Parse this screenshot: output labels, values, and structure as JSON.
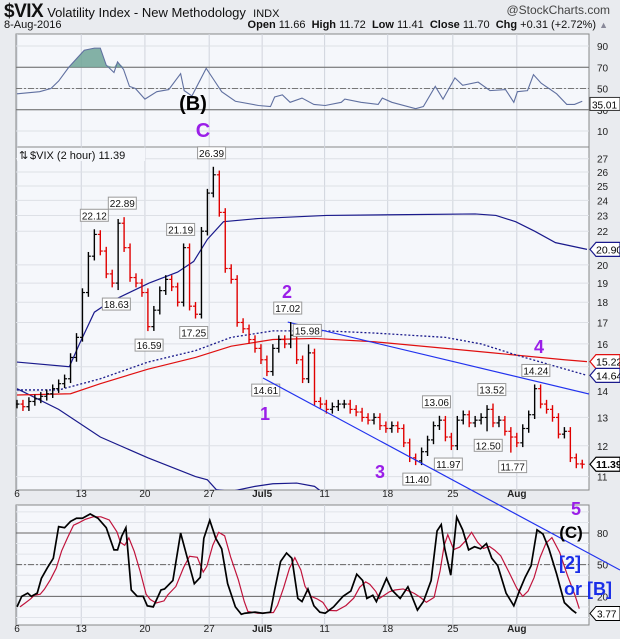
{
  "header": {
    "symbol": "$VIX",
    "name": "Volatility Index - New Methodology",
    "exchange": "INDX",
    "brand": "@StockCharts.com",
    "date": "8-Aug-2016",
    "open_label": "Open",
    "open": "11.66",
    "high_label": "High",
    "high": "11.72",
    "low_label": "Low",
    "low": "11.41",
    "close_label": "Close",
    "close": "11.70",
    "chg_label": "Chg",
    "chg": "+0.31 (+2.72%)",
    "chg_icon": "triangle-up"
  },
  "colors": {
    "up": "#000000",
    "down": "#e00000",
    "band": "#1a1a8c",
    "ma": "#e01010",
    "trend": "#2233ee",
    "wave": "#9a1ee8",
    "rsi": "#6070a0",
    "stochK": "#000000",
    "stochD": "#c0143c"
  },
  "chart_data": [
    {
      "type": "line",
      "name": "RSI",
      "yticks": [
        90,
        70,
        50,
        30,
        10
      ],
      "ylim": [
        -5,
        100
      ],
      "levels": [
        70,
        50,
        30
      ],
      "last_label": "35.01",
      "points": [
        [
          0,
          45
        ],
        [
          3.8,
          47
        ],
        [
          5.7,
          50
        ],
        [
          7,
          57
        ],
        [
          8.7,
          70
        ],
        [
          11.3,
          86
        ],
        [
          13,
          88
        ],
        [
          14,
          88
        ],
        [
          15,
          72
        ],
        [
          16.3,
          65
        ],
        [
          16.9,
          75
        ],
        [
          17.9,
          68
        ],
        [
          18.9,
          52
        ],
        [
          19.9,
          50
        ],
        [
          21.5,
          40
        ],
        [
          23.5,
          47
        ],
        [
          25.5,
          49
        ],
        [
          27.5,
          64
        ],
        [
          28.1,
          48
        ],
        [
          29.4,
          43
        ],
        [
          31.8,
          69
        ],
        [
          33.1,
          58
        ],
        [
          34.4,
          47
        ],
        [
          36.7,
          38
        ],
        [
          40.6,
          34
        ],
        [
          42.6,
          33
        ],
        [
          43.3,
          42
        ],
        [
          44.6,
          44
        ],
        [
          45.9,
          37
        ],
        [
          47.9,
          41
        ],
        [
          49.9,
          35
        ],
        [
          51.8,
          34
        ],
        [
          54.5,
          37
        ],
        [
          55.1,
          40
        ],
        [
          57.8,
          37
        ],
        [
          60.7,
          35
        ],
        [
          61.4,
          41
        ],
        [
          63,
          37
        ],
        [
          67,
          31
        ],
        [
          68.3,
          33
        ],
        [
          70.3,
          52
        ],
        [
          71.6,
          40
        ],
        [
          73.6,
          60
        ],
        [
          74.9,
          53
        ],
        [
          77.5,
          56
        ],
        [
          79.5,
          48
        ],
        [
          82.1,
          49
        ],
        [
          83.5,
          37
        ],
        [
          84.1,
          47
        ],
        [
          85.8,
          48
        ],
        [
          86.8,
          63
        ],
        [
          88.1,
          55
        ],
        [
          90.7,
          45
        ],
        [
          92.4,
          35
        ],
        [
          93.7,
          35
        ],
        [
          95,
          38
        ]
      ]
    },
    {
      "type": "ohlc",
      "name": "$VIX (2 hour)",
      "legend": "$VIX (2 hour) 11.39",
      "scale": "log",
      "yticks": [
        11,
        12,
        13,
        14,
        15,
        16,
        17,
        18,
        19,
        20,
        22,
        23,
        24,
        25,
        26,
        27
      ],
      "ylim": [
        10.5,
        28.5
      ],
      "xticks": [
        {
          "i": 0,
          "label": "6"
        },
        {
          "i": 10.8,
          "label": "13"
        },
        {
          "i": 21.5,
          "label": "20"
        },
        {
          "i": 32.3,
          "label": "27"
        },
        {
          "i": 41.2,
          "label": "Jul5"
        },
        {
          "i": 51.7,
          "label": "11"
        },
        {
          "i": 62.3,
          "label": "18"
        },
        {
          "i": 73.25,
          "label": "25"
        },
        {
          "i": 84,
          "label": "Aug"
        }
      ],
      "closes": [
        13.5,
        13.4,
        13.6,
        13.7,
        13.8,
        13.9,
        14.1,
        14.3,
        14.5,
        15.4,
        16.3,
        18.5,
        20.5,
        21.8,
        20.8,
        19.5,
        19.0,
        22.5,
        21.0,
        19.3,
        19.0,
        18.5,
        16.8,
        17.6,
        18.6,
        19.2,
        18.8,
        18.0,
        21.0,
        17.8,
        17.4,
        22.0,
        24.5,
        25.8,
        23.2,
        19.8,
        19.2,
        17.0,
        16.7,
        16.2,
        15.8,
        15.3,
        14.8,
        15.8,
        16.2,
        16.0,
        16.4,
        15.3,
        14.5,
        15.6,
        13.6,
        13.5,
        13.3,
        13.4,
        13.5,
        13.5,
        13.3,
        13.2,
        13.0,
        12.9,
        13.0,
        12.7,
        12.6,
        12.7,
        12.6,
        12.1,
        11.6,
        11.5,
        11.8,
        12.2,
        12.7,
        12.9,
        12.3,
        12.0,
        12.9,
        13.1,
        12.8,
        12.9,
        13.0,
        13.3,
        12.8,
        12.9,
        12.5,
        12.3,
        12.1,
        12.6,
        13.1,
        14.1,
        13.5,
        13.3,
        13.0,
        12.4,
        12.5,
        11.6,
        11.4,
        11.39
      ],
      "annotations": [
        {
          "i": 13,
          "v": "22.12",
          "pos": "top"
        },
        {
          "i": 17.7,
          "v": "22.89",
          "pos": "top"
        },
        {
          "i": 16.7,
          "v": "18.63",
          "pos": "bottom"
        },
        {
          "i": 22.2,
          "v": "16.59",
          "pos": "bottom"
        },
        {
          "i": 27.5,
          "v": "21.19",
          "pos": "top"
        },
        {
          "i": 29.7,
          "v": "17.25",
          "pos": "bottom"
        },
        {
          "i": 32.7,
          "v": "26.39",
          "pos": "top"
        },
        {
          "i": 45.5,
          "v": "17.02",
          "pos": "top"
        },
        {
          "i": 48.8,
          "v": "15.98",
          "pos": "top"
        },
        {
          "i": 41.8,
          "v": "14.61",
          "pos": "bottom"
        },
        {
          "i": 67.2,
          "v": "11.40",
          "pos": "bottom"
        },
        {
          "i": 70.5,
          "v": "13.06",
          "pos": "top"
        },
        {
          "i": 72.5,
          "v": "11.97",
          "pos": "bottom"
        },
        {
          "i": 79.8,
          "v": "13.52",
          "pos": "top"
        },
        {
          "i": 79.2,
          "v": "12.50",
          "pos": "bottom"
        },
        {
          "i": 83.3,
          "v": "11.77",
          "pos": "bottom"
        },
        {
          "i": 87.2,
          "v": "14.24",
          "pos": "top"
        }
      ],
      "overlays": [
        {
          "name": "upper-band",
          "style": "band",
          "last": "20.90",
          "points": [
            [
              0,
              15.2
            ],
            [
              8.8,
              15.0
            ],
            [
              10.5,
              16
            ],
            [
              13,
              17.5
            ],
            [
              15.5,
              18
            ],
            [
              22.2,
              19
            ],
            [
              27,
              19.6
            ],
            [
              29.7,
              20.2
            ],
            [
              32,
              21.5
            ],
            [
              34.7,
              22.6
            ],
            [
              40.5,
              22.8
            ],
            [
              52,
              23
            ],
            [
              77,
              23.1
            ],
            [
              80.5,
              23
            ],
            [
              83.8,
              22.6
            ],
            [
              87,
              22
            ],
            [
              90.5,
              21.3
            ],
            [
              95.8,
              20.9
            ]
          ]
        },
        {
          "name": "lower-band",
          "style": "band",
          "points": [
            [
              0,
              14.1
            ],
            [
              7,
              13.3
            ],
            [
              14,
              12.3
            ],
            [
              22,
              11.6
            ],
            [
              30,
              11.0
            ],
            [
              32,
              10.9
            ],
            [
              33.5,
              10.6
            ],
            [
              36,
              10.55
            ],
            [
              40,
              10.7
            ],
            [
              43,
              10.78
            ],
            [
              47,
              10.8
            ],
            [
              50,
              10.7
            ],
            [
              51.5,
              10.5
            ]
          ]
        },
        {
          "name": "moving-average",
          "style": "ma",
          "last": "15.22",
          "points": [
            [
              0,
              13.85
            ],
            [
              9,
              13.9
            ],
            [
              14,
              14.3
            ],
            [
              22,
              14.9
            ],
            [
              30,
              15.4
            ],
            [
              36,
              15.9
            ],
            [
              43,
              16.2
            ],
            [
              50,
              16.25
            ],
            [
              60,
              16.1
            ],
            [
              70,
              15.85
            ],
            [
              80,
              15.6
            ],
            [
              92,
              15.3
            ],
            [
              95.8,
              15.22
            ]
          ]
        },
        {
          "name": "dotted-average",
          "style": "dotted",
          "last": "14.64",
          "points": [
            [
              0,
              14.05
            ],
            [
              7,
              14.05
            ],
            [
              14,
              14.5
            ],
            [
              22,
              15.2
            ],
            [
              30,
              15.7
            ],
            [
              36,
              16.3
            ],
            [
              43,
              16.6
            ],
            [
              52,
              16.6
            ],
            [
              60,
              16.5
            ],
            [
              72,
              16.3
            ],
            [
              78,
              16.0
            ],
            [
              84,
              15.5
            ],
            [
              95.8,
              14.64
            ]
          ]
        }
      ],
      "trendline": [
        [
          45.5,
          17.02
        ],
        [
          100.5,
          13.65
        ]
      ],
      "last_label": "11.39"
    },
    {
      "type": "line",
      "name": "Stochastic",
      "yticks": [
        80,
        50,
        20
      ],
      "ylim": [
        -8,
        106
      ],
      "levels": [
        80,
        50,
        20
      ],
      "last_label": "3.77",
      "k": [
        [
          0,
          10
        ],
        [
          0.8,
          20
        ],
        [
          1.8,
          23
        ],
        [
          2.4,
          20
        ],
        [
          3.4,
          23
        ],
        [
          4.1,
          37
        ],
        [
          5.1,
          47
        ],
        [
          6.1,
          56
        ],
        [
          7,
          86
        ],
        [
          8,
          85
        ],
        [
          9,
          91
        ],
        [
          10,
          94
        ],
        [
          11,
          94
        ],
        [
          12.3,
          98
        ],
        [
          13.6,
          94
        ],
        [
          15,
          85
        ],
        [
          16.3,
          64
        ],
        [
          16.9,
          64
        ],
        [
          17.6,
          77
        ],
        [
          18.3,
          85
        ],
        [
          19.2,
          26
        ],
        [
          20.2,
          20
        ],
        [
          21.2,
          20
        ],
        [
          21.9,
          11
        ],
        [
          22.9,
          10
        ],
        [
          24.2,
          26
        ],
        [
          24.8,
          27
        ],
        [
          26.2,
          35
        ],
        [
          27.5,
          80
        ],
        [
          28.5,
          59
        ],
        [
          29.8,
          32
        ],
        [
          30.8,
          38
        ],
        [
          31.4,
          75
        ],
        [
          32.4,
          92
        ],
        [
          33.4,
          75
        ],
        [
          34.4,
          65
        ],
        [
          35.4,
          32
        ],
        [
          36.7,
          10
        ],
        [
          37.7,
          3
        ],
        [
          38.3,
          4
        ],
        [
          40,
          5
        ],
        [
          41.3,
          4
        ],
        [
          42.6,
          5
        ],
        [
          43.3,
          26
        ],
        [
          44.3,
          53
        ],
        [
          45.3,
          61
        ],
        [
          46.2,
          56
        ],
        [
          47.2,
          18
        ],
        [
          47.9,
          15
        ],
        [
          48.9,
          27
        ],
        [
          49.9,
          11
        ],
        [
          50.9,
          5
        ],
        [
          51.8,
          4
        ],
        [
          53.2,
          10
        ],
        [
          54.8,
          20
        ],
        [
          56.1,
          25
        ],
        [
          57.1,
          41
        ],
        [
          58.1,
          35
        ],
        [
          58.8,
          18
        ],
        [
          59.8,
          21
        ],
        [
          60.4,
          15
        ],
        [
          62.1,
          37
        ],
        [
          63,
          26
        ],
        [
          64.4,
          18
        ],
        [
          65.7,
          29
        ],
        [
          66.3,
          21
        ],
        [
          67.3,
          7
        ],
        [
          68.3,
          15
        ],
        [
          69.6,
          35
        ],
        [
          70.6,
          82
        ],
        [
          71.3,
          88
        ],
        [
          71.9,
          65
        ],
        [
          72.9,
          40
        ],
        [
          73.9,
          95
        ],
        [
          74.9,
          83
        ],
        [
          75.9,
          64
        ],
        [
          76.9,
          67
        ],
        [
          77.9,
          65
        ],
        [
          78.9,
          70
        ],
        [
          79.8,
          56
        ],
        [
          80.8,
          49
        ],
        [
          82.2,
          23
        ],
        [
          83.5,
          11
        ],
        [
          84.5,
          26
        ],
        [
          85.4,
          38
        ],
        [
          86.4,
          49
        ],
        [
          87.4,
          83
        ],
        [
          88.4,
          79
        ],
        [
          89.4,
          65
        ],
        [
          90.7,
          41
        ],
        [
          92,
          14
        ],
        [
          93.3,
          7
        ],
        [
          94,
          4
        ]
      ]
    }
  ],
  "waves": {
    "B_paren": "(B)",
    "C": "C",
    "w1": "1",
    "w2": "2",
    "w3": "3",
    "w4": "4",
    "w5": "5",
    "C_paren": "(C)",
    "alt2": "[2]",
    "alt_or": "or [B]"
  }
}
